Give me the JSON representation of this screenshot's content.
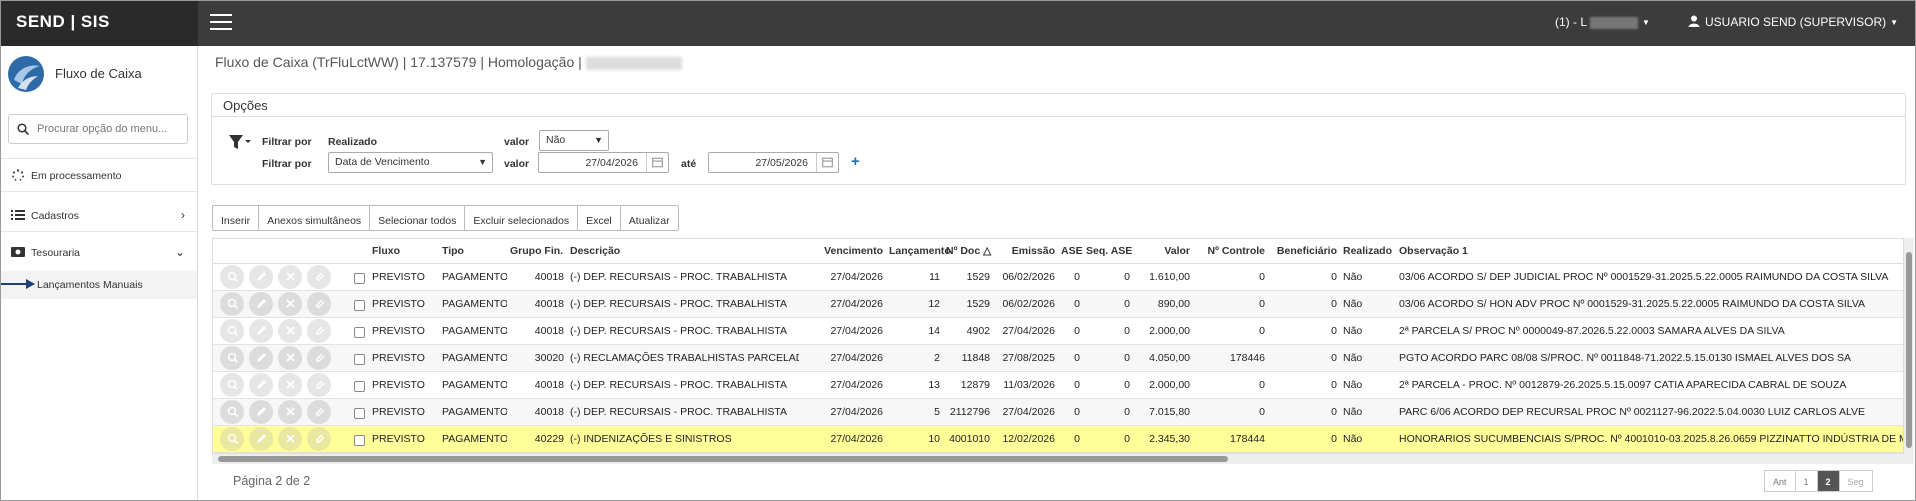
{
  "app": {
    "brand": "SEND | SIS"
  },
  "header": {
    "env_label": "(1) - L",
    "user_label": "USUARIO SEND (SUPERVISOR)"
  },
  "sidebar": {
    "title": "Fluxo de Caixa",
    "search_placeholder": "Procurar opção do menu...",
    "items": [
      {
        "label": "Em processamento",
        "icon": "spinner-icon"
      },
      {
        "label": "Cadastros",
        "icon": "list-icon"
      },
      {
        "label": "Tesouraria",
        "icon": "money-icon"
      }
    ],
    "sub_item": "Lançamentos Manuais"
  },
  "breadcrumb": "Fluxo de Caixa (TrFluLctWW) | 17.137579 | Homologação |",
  "options": {
    "title": "Opções",
    "filter1_label": "Filtrar por",
    "filter1_field": "Realizado",
    "valor_label": "valor",
    "filter1_value": "Não",
    "filter2_label": "Filtrar por",
    "filter2_field": "Data de Vencimento",
    "valor2_label": "valor",
    "date_from": "27/04/2026",
    "ate_label": "até",
    "date_to": "27/05/2026"
  },
  "toolbar": [
    "Inserir",
    "Anexos simultâneos",
    "Selecionar todos",
    "Excluir selecionados",
    "Excel",
    "Atualizar"
  ],
  "table": {
    "columns": [
      "Fluxo",
      "Tipo",
      "Grupo Fin.",
      "Descrição",
      "Vencimento",
      "Lançamento",
      "Nº Doc",
      "Emissão",
      "ASE",
      "Seq. ASE",
      "Valor",
      "Nº Controle",
      "Beneficiário",
      "Realizado",
      "Observação 1"
    ],
    "rows": [
      [
        "PREVISTO",
        "PAGAMENTO",
        "40018",
        "(-) DEP. RECURSAIS - PROC. TRABALHISTA",
        "27/04/2026",
        "11",
        "1529",
        "06/02/2026",
        "0",
        "0",
        "1.610,00",
        "0",
        "0",
        "Não",
        "03/06 ACORDO S/ DEP JUDICIAL PROC Nº 0001529-31.2025.5.22.0005 RAIMUNDO DA COSTA SILVA"
      ],
      [
        "PREVISTO",
        "PAGAMENTO",
        "40018",
        "(-) DEP. RECURSAIS - PROC. TRABALHISTA",
        "27/04/2026",
        "12",
        "1529",
        "06/02/2026",
        "0",
        "0",
        "890,00",
        "0",
        "0",
        "Não",
        "03/06 ACORDO S/ HON ADV PROC Nº 0001529-31.2025.5.22.0005 RAIMUNDO DA COSTA SILVA"
      ],
      [
        "PREVISTO",
        "PAGAMENTO",
        "40018",
        "(-) DEP. RECURSAIS - PROC. TRABALHISTA",
        "27/04/2026",
        "14",
        "4902",
        "27/04/2026",
        "0",
        "0",
        "2.000,00",
        "0",
        "0",
        "Não",
        "2ª PARCELA S/ PROC Nº 0000049-87.2026.5.22.0003 SAMARA ALVES DA SILVA"
      ],
      [
        "PREVISTO",
        "PAGAMENTO",
        "30020",
        "(-) RECLAMAÇÕES TRABALHISTAS PARCELADA",
        "27/04/2026",
        "2",
        "11848",
        "27/08/2025",
        "0",
        "0",
        "4.050,00",
        "178446",
        "0",
        "Não",
        "PGTO ACORDO PARC 08/08 S/PROC. Nº 0011848-71.2022.5.15.0130 ISMAEL ALVES DOS SA"
      ],
      [
        "PREVISTO",
        "PAGAMENTO",
        "40018",
        "(-) DEP. RECURSAIS - PROC. TRABALHISTA",
        "27/04/2026",
        "13",
        "12879",
        "11/03/2026",
        "0",
        "0",
        "2.000,00",
        "0",
        "0",
        "Não",
        "2ª PARCELA - PROC. Nº 0012879-26.2025.5.15.0097 CATIA APARECIDA CABRAL DE SOUZA"
      ],
      [
        "PREVISTO",
        "PAGAMENTO",
        "40018",
        "(-) DEP. RECURSAIS - PROC. TRABALHISTA",
        "27/04/2026",
        "5",
        "2112796",
        "27/04/2026",
        "0",
        "0",
        "7.015,80",
        "0",
        "0",
        "Não",
        "PARC 6/06 ACORDO DEP RECURSAL PROC Nº 0021127-96.2022.5.04.0030 LUIZ CARLOS ALVE"
      ],
      [
        "PREVISTO",
        "PAGAMENTO",
        "40229",
        "(-) INDENIZAÇÕES E SINISTROS",
        "27/04/2026",
        "10",
        "4001010",
        "12/02/2026",
        "0",
        "0",
        "2.345,30",
        "178444",
        "0",
        "Não",
        "HONORARIOS SUCUMBENCIAIS S/PROC. Nº 4001010-03.2025.8.26.0659 PIZZINATTO INDÚSTRIA DE META"
      ]
    ]
  },
  "footer": {
    "page_text": "Página 2 de 2",
    "pager": [
      "Ant",
      "1",
      "2",
      "Seg"
    ]
  },
  "colors": {
    "topbar": "#3c3c3c",
    "highlight_row": "#ffff99",
    "accent": "#1f6fb3"
  }
}
